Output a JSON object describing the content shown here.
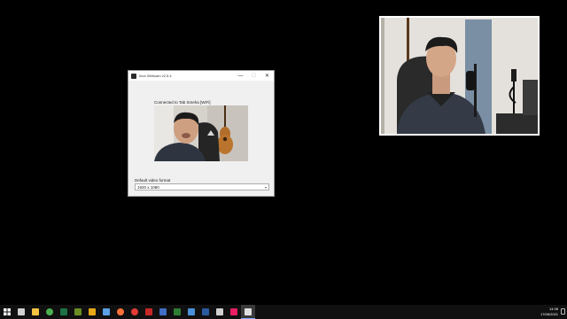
{
  "window": {
    "title": "Iriun Webcam v2.5.4",
    "status": "Connected to Tab Smeha [WiFi]",
    "format_label": "Default video format",
    "format_value": "1920 x 1080"
  },
  "titlebar_buttons": {
    "minimize": "—",
    "maximize": "☐",
    "close": "✕"
  },
  "taskbar": {
    "time": "14:38",
    "date": "17/06/2021",
    "icons": [
      {
        "name": "search-icon",
        "color": "#d0d0d0"
      },
      {
        "name": "file-explorer-icon",
        "color": "#f5c342"
      },
      {
        "name": "chrome-icon",
        "color": "#4caf50"
      },
      {
        "name": "excel-icon",
        "color": "#1e7145"
      },
      {
        "name": "app-icon",
        "color": "#6b8e23"
      },
      {
        "name": "app-icon",
        "color": "#e6a817"
      },
      {
        "name": "app-icon",
        "color": "#5aa0e6"
      },
      {
        "name": "firefox-icon",
        "color": "#ff7139"
      },
      {
        "name": "record-icon",
        "color": "#e53935"
      },
      {
        "name": "app-icon",
        "color": "#c62828"
      },
      {
        "name": "app-icon",
        "color": "#3f6ec4"
      },
      {
        "name": "app-icon",
        "color": "#2e7d32"
      },
      {
        "name": "app-icon",
        "color": "#4a90d9"
      },
      {
        "name": "media-player-icon",
        "color": "#2c5aa0"
      },
      {
        "name": "app-icon",
        "color": "#d0d0d0"
      },
      {
        "name": "app-icon",
        "color": "#e91e63"
      },
      {
        "name": "iriun-webcam-icon",
        "color": "#e0e0e0"
      }
    ]
  }
}
